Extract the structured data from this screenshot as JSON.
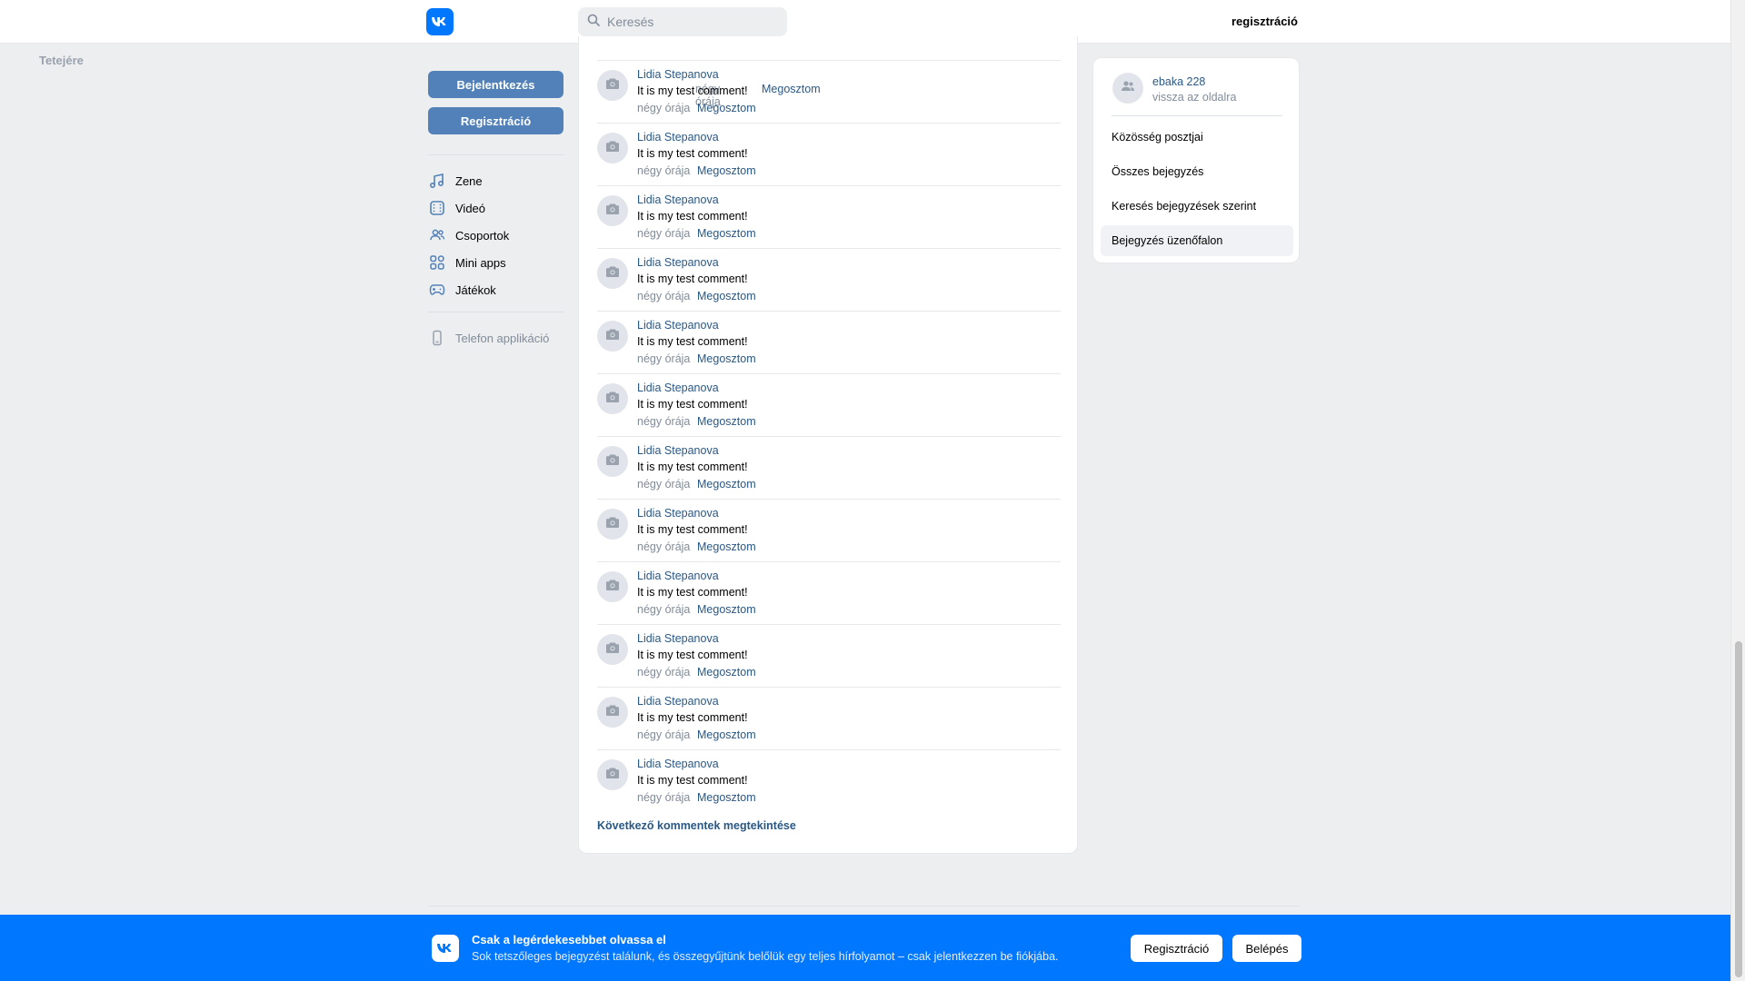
{
  "header": {
    "logo": "vk-logo-icon",
    "search_placeholder": "Keresés",
    "register_link": "regisztráció"
  },
  "to_top": "Tetejére",
  "sidebar": {
    "login_button": "Bejelentkezés",
    "register_button": "Regisztráció",
    "items": [
      {
        "label": "Zene",
        "icon": "music-icon"
      },
      {
        "label": "Videó",
        "icon": "video-icon"
      },
      {
        "label": "Csoportok",
        "icon": "groups-icon"
      },
      {
        "label": "Mini apps",
        "icon": "apps-icon"
      },
      {
        "label": "Játékok",
        "icon": "gamepad-icon"
      }
    ],
    "phone_app": {
      "label": "Telefon applikáció",
      "icon": "phone-icon"
    }
  },
  "comments": {
    "partial_top": {
      "time": "négy órája",
      "share": "Megosztom"
    },
    "items": [
      {
        "author": "Lidia Stepanova",
        "text": "It is my test comment!",
        "time": "négy órája",
        "share": "Megosztom"
      },
      {
        "author": "Lidia Stepanova",
        "text": "It is my test comment!",
        "time": "négy órája",
        "share": "Megosztom"
      },
      {
        "author": "Lidia Stepanova",
        "text": "It is my test comment!",
        "time": "négy órája",
        "share": "Megosztom"
      },
      {
        "author": "Lidia Stepanova",
        "text": "It is my test comment!",
        "time": "négy órája",
        "share": "Megosztom"
      },
      {
        "author": "Lidia Stepanova",
        "text": "It is my test comment!",
        "time": "négy órája",
        "share": "Megosztom"
      },
      {
        "author": "Lidia Stepanova",
        "text": "It is my test comment!",
        "time": "négy órája",
        "share": "Megosztom"
      },
      {
        "author": "Lidia Stepanova",
        "text": "It is my test comment!",
        "time": "négy órája",
        "share": "Megosztom"
      },
      {
        "author": "Lidia Stepanova",
        "text": "It is my test comment!",
        "time": "négy órája",
        "share": "Megosztom"
      },
      {
        "author": "Lidia Stepanova",
        "text": "It is my test comment!",
        "time": "négy órája",
        "share": "Megosztom"
      },
      {
        "author": "Lidia Stepanova",
        "text": "It is my test comment!",
        "time": "négy órája",
        "share": "Megosztom"
      },
      {
        "author": "Lidia Stepanova",
        "text": "It is my test comment!",
        "time": "négy órája",
        "share": "Megosztom"
      },
      {
        "author": "Lidia Stepanova",
        "text": "It is my test comment!",
        "time": "négy órája",
        "share": "Megosztom"
      }
    ],
    "more": "Következő kommentek megtekintése"
  },
  "right_panel": {
    "group_name": "ebaka 228",
    "back": "vissza az oldalra",
    "menu": [
      {
        "label": "Közösség posztjai",
        "active": false
      },
      {
        "label": "Összes bejegyzés",
        "active": false
      },
      {
        "label": "Keresés bejegyzések szerint",
        "active": false
      },
      {
        "label": "Bejegyzés üzenőfalon",
        "active": true
      }
    ]
  },
  "banner": {
    "title": "Csak a legérdekesebbet olvassa el",
    "subtitle": "Sok tetszőleges bejegyzést találunk, és összegyűjtünk belőlük egy teljes hírfolyamot – csak jelentkezzen be fiókjába.",
    "register_button": "Regisztráció",
    "login_button": "Belépés"
  },
  "colors": {
    "vk_blue": "#0077ff",
    "button_blue": "#5181b8",
    "link_blue": "#2a5885",
    "muted": "#818c99",
    "background": "#edeef0"
  }
}
